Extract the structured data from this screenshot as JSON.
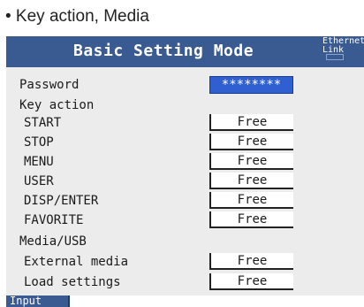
{
  "caption": "• Key action, Media",
  "title": "Basic Setting Mode",
  "ethernet": {
    "line1": "Ethernet",
    "line2": "Link"
  },
  "password": {
    "label": "Password",
    "value": "********"
  },
  "key_action": {
    "heading": "Key action",
    "items": [
      {
        "label": "START",
        "value": "Free"
      },
      {
        "label": "STOP",
        "value": "Free"
      },
      {
        "label": "MENU",
        "value": "Free"
      },
      {
        "label": "USER",
        "value": "Free"
      },
      {
        "label": "DISP/ENTER",
        "value": "Free"
      },
      {
        "label": "FAVORITE",
        "value": "Free"
      }
    ]
  },
  "media": {
    "heading": "Media/USB",
    "items": [
      {
        "label": "External media",
        "value": "Free"
      },
      {
        "label": "Load settings",
        "value": "Free"
      }
    ]
  },
  "status_tab": "Input"
}
